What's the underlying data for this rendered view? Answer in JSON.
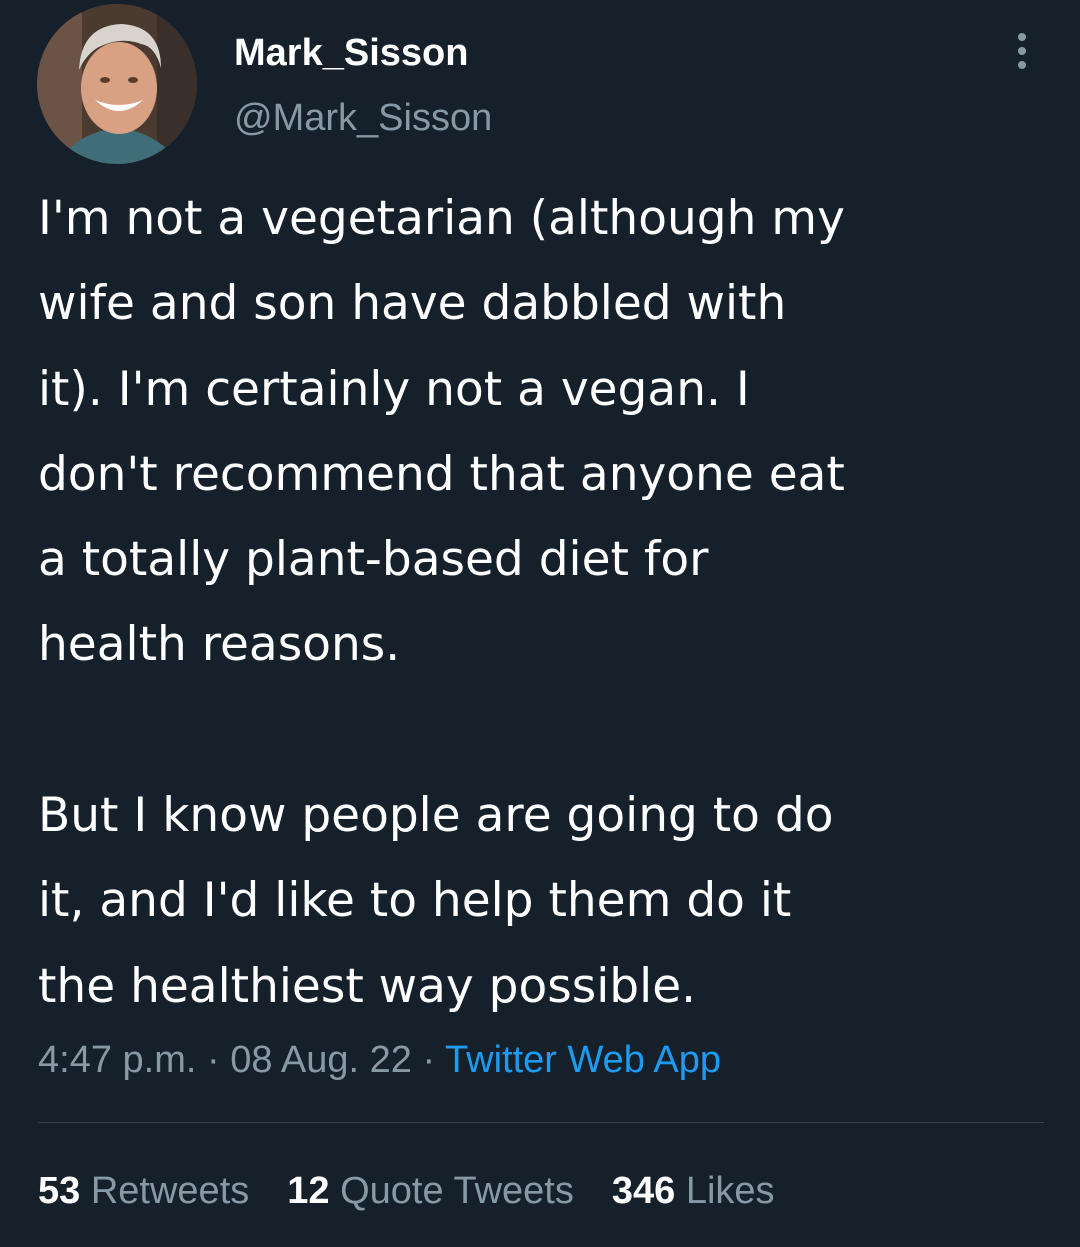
{
  "tweet": {
    "author": {
      "display_name": "Mark_Sisson",
      "handle": "@Mark_Sisson",
      "avatar_icon": "profile-photo"
    },
    "more_icon": "more-vertical-icon",
    "text": "I'm not a vegetarian (although my\nwife and son have dabbled with\nit). I'm certainly not a vegan. I\ndon't recommend that anyone eat\na totally plant-based diet for\nhealth reasons.\n\nBut I know people are going to do\nit, and I'd like to help them do it\nthe healthiest way possible.",
    "time": "4:47 p.m.",
    "separator": " · ",
    "date": "08 Aug. 22",
    "source": "Twitter Web App",
    "stats": {
      "retweets_count": "53",
      "retweets_label": "Retweets",
      "quotes_count": "12",
      "quotes_label": "Quote Tweets",
      "likes_count": "346",
      "likes_label": "Likes"
    }
  },
  "colors": {
    "background": "#15202b",
    "primary_text": "#ffffff",
    "secondary_text": "#8899a6",
    "link": "#1d9bf0",
    "divider": "#38444d"
  }
}
